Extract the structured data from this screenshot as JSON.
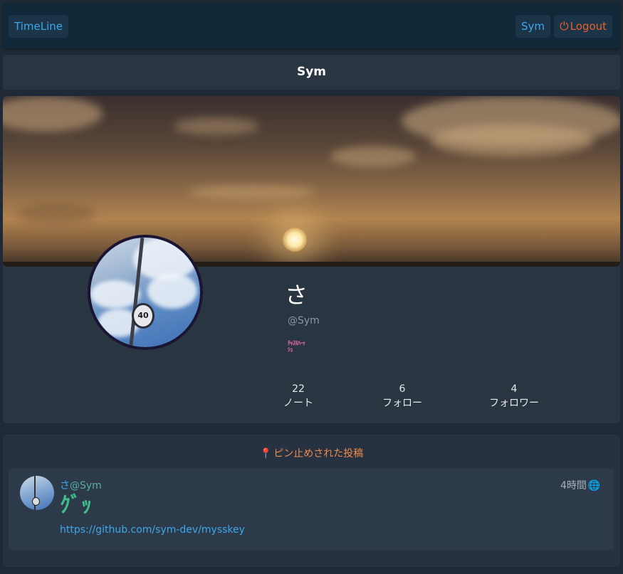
{
  "navbar": {
    "timeline_label": "TimeLine",
    "user_label": "Sym",
    "logout_label": "Logout",
    "logout_icon": "power-icon"
  },
  "title": "Sym",
  "profile": {
    "display_name": "さ",
    "acct": "@Sym",
    "custom_emoji_text": "ﾁｬｽﾓﾊｰｯｼｭ",
    "stats": [
      {
        "value": "22",
        "label": "ノート"
      },
      {
        "value": "6",
        "label": "フォロー"
      },
      {
        "value": "4",
        "label": "フォロワー"
      }
    ]
  },
  "pinned": {
    "header": "ピン止めされた投稿",
    "header_icon": "pin-icon",
    "note": {
      "author_name": "さ",
      "author_acct": "@Sym",
      "time": "4時間",
      "visibility_icon": "globe-icon",
      "emoji_text": "ｸﾞｯ",
      "link": "https://github.com/sym-dev/mysskey"
    }
  },
  "colors": {
    "accent": "#3ca8ec",
    "logout": "#e5622a",
    "pinned": "#f08a4b",
    "background": "#1f2a36"
  }
}
